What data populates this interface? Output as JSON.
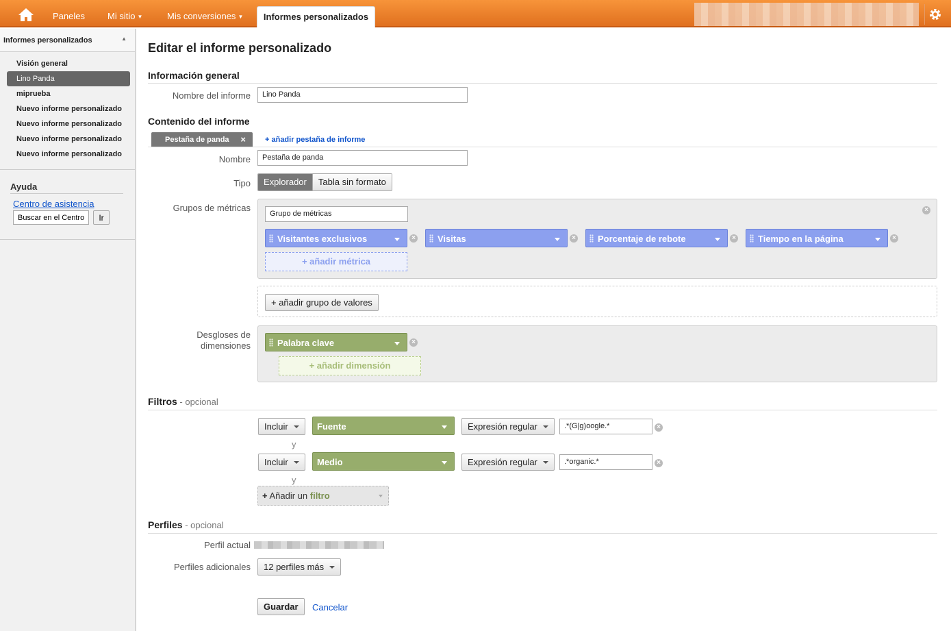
{
  "topbar": {
    "home_icon": "home-icon",
    "nav": [
      "Paneles",
      "Mi sitio",
      "Mis conversiones"
    ],
    "active_tab": "Informes personalizados",
    "settings_icon": "gear-icon"
  },
  "sidebar": {
    "header": "Informes personalizados",
    "items": [
      "Visión general",
      "Lino Panda",
      "miprueba",
      "Nuevo informe personalizado",
      "Nuevo informe personalizado",
      "Nuevo informe personalizado",
      "Nuevo informe personalizado"
    ],
    "active_index": 1,
    "help": {
      "title": "Ayuda",
      "link": "Centro de asistencia",
      "search_value": "Buscar en el Centro d",
      "go_button": "Ir"
    }
  },
  "main": {
    "page_title": "Editar el informe personalizado",
    "general": {
      "title": "Información general",
      "name_label": "Nombre del informe",
      "name_value": "Lino Panda"
    },
    "content": {
      "title": "Contenido del informe",
      "tab_label": "Pestaña de panda",
      "add_tab": "+ añadir pestaña de informe",
      "name_label": "Nombre",
      "name_value": "Pestaña de panda",
      "type_label": "Tipo",
      "type_options": [
        "Explorador",
        "Tabla sin formato"
      ],
      "metrics_label": "Grupos de métricas",
      "metric_group_name": "Grupo de métricas",
      "metrics": [
        "Visitantes exclusivos",
        "Visitas",
        "Porcentaje de rebote",
        "Tiempo en la página"
      ],
      "add_metric": "+ añadir métrica",
      "add_value_group": "+ añadir grupo de valores",
      "dimensions_label_1": "Desgloses de",
      "dimensions_label_2": "dimensiones",
      "dimension": "Palabra clave",
      "add_dimension": "+ añadir dimensión"
    },
    "filters": {
      "title": "Filtros",
      "optional": " - opcional",
      "rows": [
        {
          "include": "Incluir",
          "field": "Fuente",
          "match": "Expresión regular",
          "value": ".*(G|g)oogle.*"
        },
        {
          "include": "Incluir",
          "field": "Medio",
          "match": "Expresión regular",
          "value": ".*organic.*"
        }
      ],
      "and": "y",
      "add_filter_prefix": "+",
      "add_filter_text": " Añadir un ",
      "add_filter_word": "filtro"
    },
    "profiles": {
      "title": "Perfiles",
      "optional": " - opcional",
      "current_label": "Perfil actual",
      "additional_label": "Perfiles adicionales",
      "additional_value": "12 perfiles más"
    },
    "actions": {
      "save": "Guardar",
      "cancel": "Cancelar"
    }
  }
}
